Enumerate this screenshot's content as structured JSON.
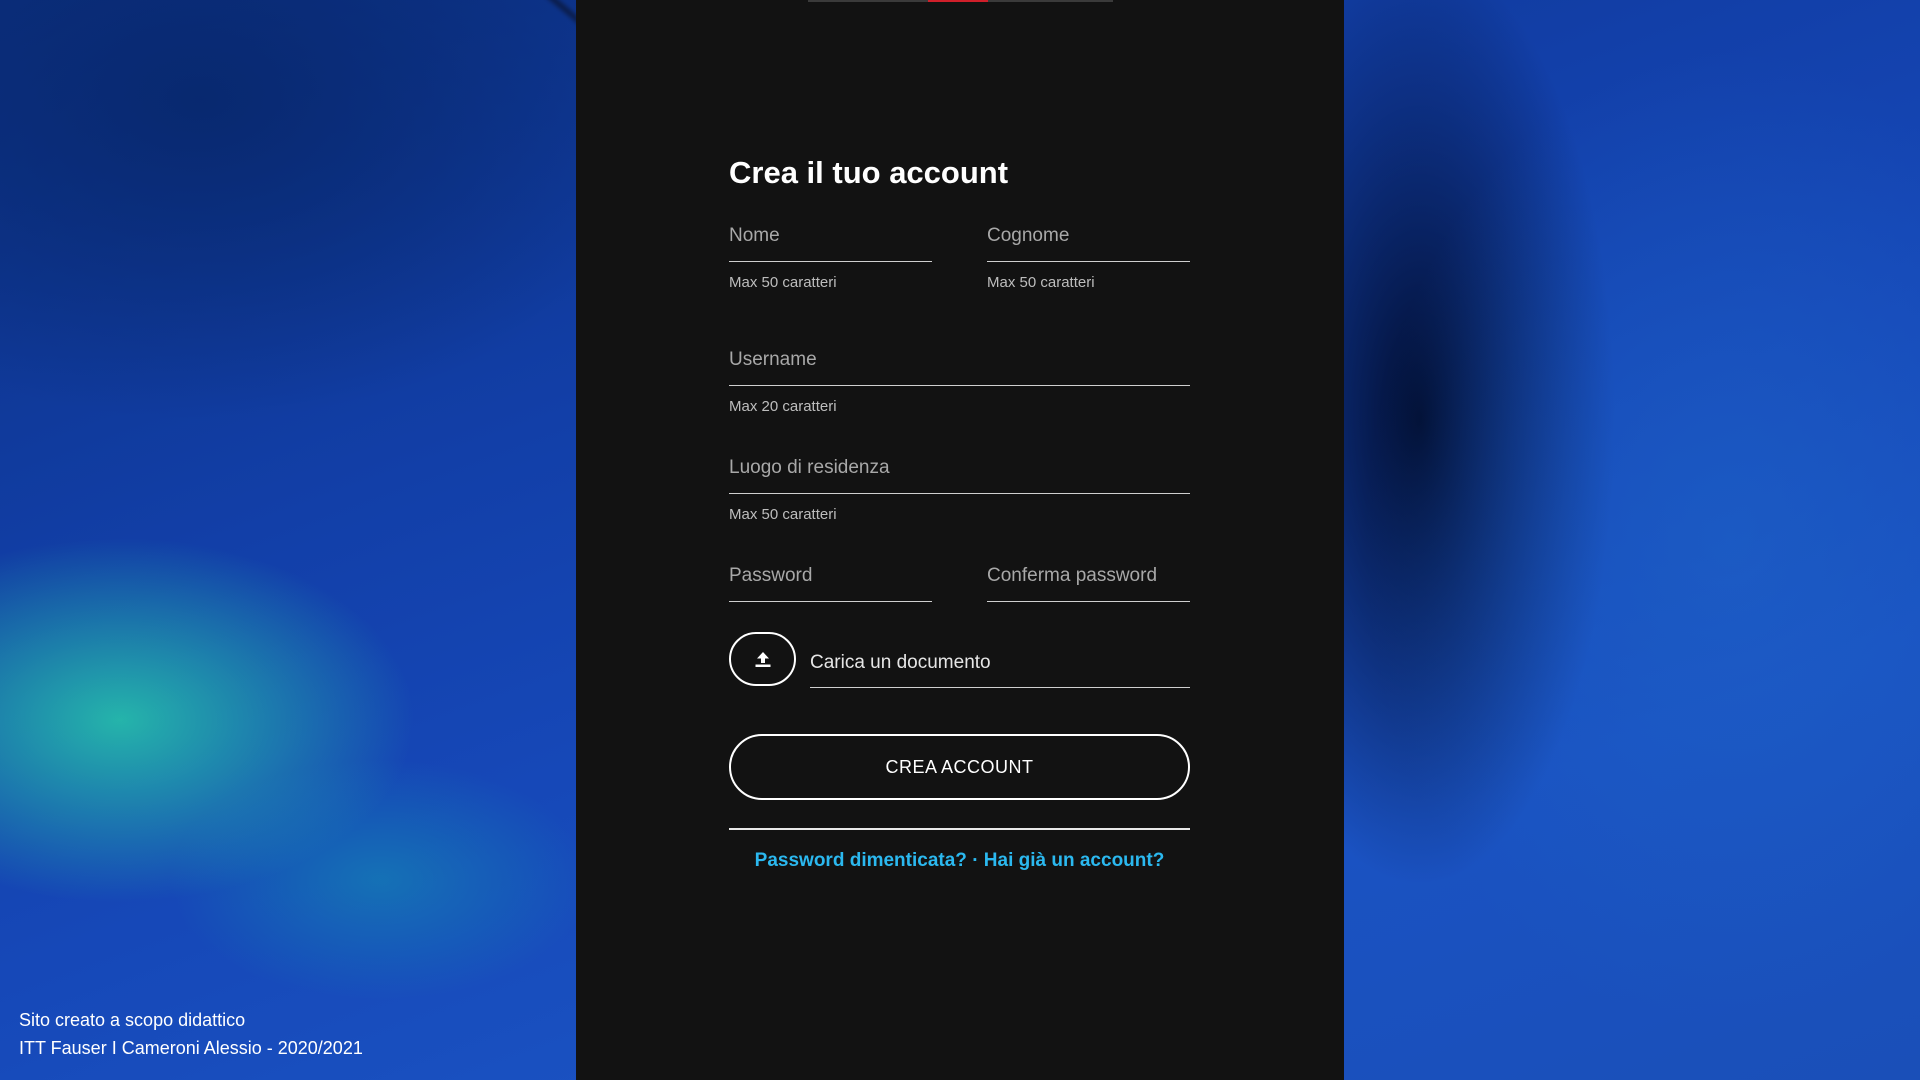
{
  "form": {
    "title": "Crea il tuo account",
    "fields": {
      "nome": {
        "placeholder": "Nome",
        "hint": "Max 50 caratteri"
      },
      "cognome": {
        "placeholder": "Cognome",
        "hint": "Max 50 caratteri"
      },
      "username": {
        "placeholder": "Username",
        "hint": "Max 20 caratteri"
      },
      "residenza": {
        "placeholder": "Luogo di residenza",
        "hint": "Max 50 caratteri"
      },
      "password": {
        "placeholder": "Password"
      },
      "conferma": {
        "placeholder": "Conferma password"
      }
    },
    "upload": {
      "label": "Carica un documento",
      "icon": "upload-icon"
    },
    "submit_label": "CREA ACCOUNT",
    "links": {
      "forgot": "Password dimenticata?",
      "separator": "·",
      "login": "Hai già un account?"
    }
  },
  "footer": {
    "line1": "Sito creato a scopo didattico",
    "line2": "ITT Fauser I Cameroni Alessio - 2020/2021"
  },
  "colors": {
    "panel": "#121212",
    "link": "#2bb8ef",
    "accent": "#d01f2a"
  }
}
